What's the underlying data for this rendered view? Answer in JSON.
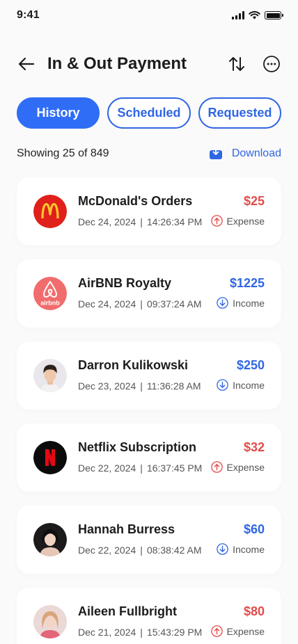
{
  "status_bar": {
    "time": "9:41"
  },
  "header": {
    "title": "In & Out Payment"
  },
  "tabs": [
    {
      "label": "History",
      "active": true
    },
    {
      "label": "Scheduled",
      "active": false
    },
    {
      "label": "Requested",
      "active": false
    }
  ],
  "summary": {
    "text": "Showing 25 of 849",
    "download_label": "Download"
  },
  "transactions": [
    {
      "name": "McDonald's Orders",
      "date": "Dec 24, 2024",
      "time": "14:26:34 PM",
      "amount": "$25",
      "type": "Expense",
      "avatar": "mcdonalds-logo"
    },
    {
      "name": "AirBNB Royalty",
      "date": "Dec 24, 2024",
      "time": "09:37:24 AM",
      "amount": "$1225",
      "type": "Income",
      "avatar": "airbnb-logo"
    },
    {
      "name": "Darron Kulikowski",
      "date": "Dec 23, 2024",
      "time": "11:36:28 AM",
      "amount": "$250",
      "type": "Income",
      "avatar": "person-photo"
    },
    {
      "name": "Netflix Subscription",
      "date": "Dec 22, 2024",
      "time": "16:37:45 PM",
      "amount": "$32",
      "type": "Expense",
      "avatar": "netflix-logo"
    },
    {
      "name": "Hannah Burress",
      "date": "Dec 22, 2024",
      "time": "08:38:42 AM",
      "amount": "$60",
      "type": "Income",
      "avatar": "person-photo"
    },
    {
      "name": "Aileen Fullbright",
      "date": "Dec 21, 2024",
      "time": "15:43:29 PM",
      "amount": "$80",
      "type": "Expense",
      "avatar": "person-photo"
    }
  ],
  "colors": {
    "primary": "#2f6df6",
    "income": "#2f66e3",
    "expense": "#e24b4b",
    "mcdonalds_red": "#e0201b",
    "mcdonalds_yellow": "#ffc72c",
    "airbnb": "#f16d6d",
    "netflix_red": "#e50914"
  }
}
